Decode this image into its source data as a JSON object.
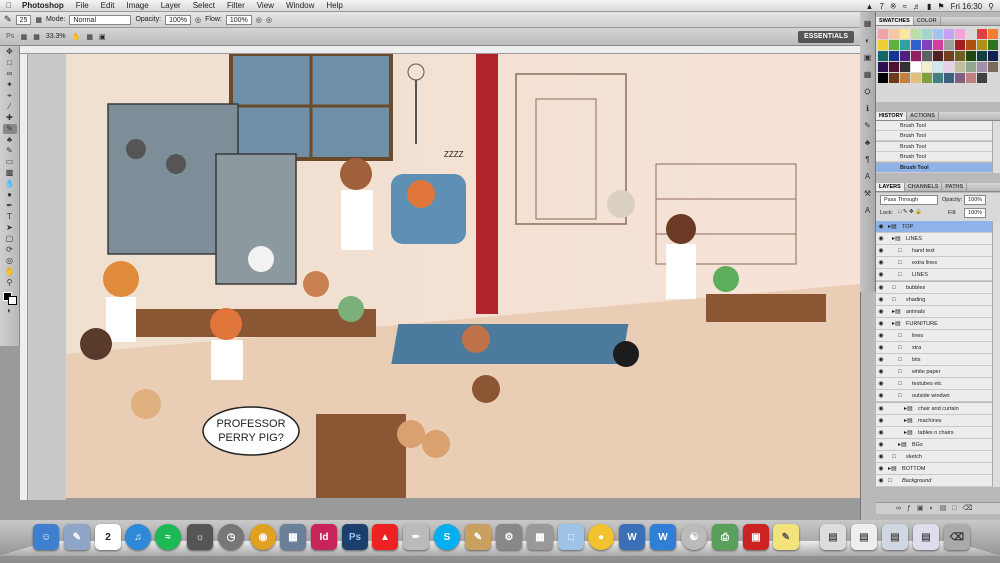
{
  "menubar": {
    "app": "Photoshop",
    "items": [
      "File",
      "Edit",
      "Image",
      "Layer",
      "Select",
      "Filter",
      "View",
      "Window",
      "Help"
    ],
    "clock": "Fri 16:30",
    "num_badge": "7"
  },
  "options": {
    "brush_size": "25",
    "mode_label": "Mode:",
    "mode_value": "Normal",
    "opacity_label": "Opacity:",
    "opacity_value": "100%",
    "flow_label": "Flow:",
    "flow_value": "100%"
  },
  "appbar": {
    "ps_logo": "Ps",
    "zoom": "33.3%",
    "workspace": "ESSENTIALS"
  },
  "canvas": {
    "speech_line1": "PROFESSOR",
    "speech_line2": "PERRY PIG?",
    "sleep_text": "ZZZZ"
  },
  "swatch_tabs": [
    "SWATCHES",
    "COLOR"
  ],
  "history_tabs": [
    "HISTORY",
    "ACTIONS"
  ],
  "history_items": [
    "Brush Tool",
    "Brush Tool",
    "Brush Tool",
    "Brush Tool",
    "Brush Tool"
  ],
  "layers_tabs": [
    "LAYERS",
    "CHANNELS",
    "PATHS"
  ],
  "layers": {
    "blend_mode": "Pass Through",
    "opacity_label": "Opacity:",
    "opacity_value": "100%",
    "lock_label": "Lock:",
    "fill_label": "Fill:",
    "fill_value": "100%",
    "items": [
      {
        "name": "TOP"
      },
      {
        "name": "LINES"
      },
      {
        "name": "hand text"
      },
      {
        "name": "extra lines"
      },
      {
        "name": "LINES"
      },
      {
        "name": "bubbles"
      },
      {
        "name": "shading"
      },
      {
        "name": "animals"
      },
      {
        "name": "FURNITURE"
      },
      {
        "name": "lines"
      },
      {
        "name": "xtra"
      },
      {
        "name": "bits"
      },
      {
        "name": "white paper"
      },
      {
        "name": "testubes etc"
      },
      {
        "name": "outside windwo"
      },
      {
        "name": "chair and curtain"
      },
      {
        "name": "machines"
      },
      {
        "name": "tables n chairs"
      },
      {
        "name": "BGs"
      },
      {
        "name": "sketch"
      },
      {
        "name": "BOTTOM"
      },
      {
        "name": "Background"
      }
    ]
  },
  "dock": {
    "calendar_day": "2"
  },
  "colors": {
    "selection": "#8fb3e8",
    "canvas_bg": "#f3e3d2"
  }
}
